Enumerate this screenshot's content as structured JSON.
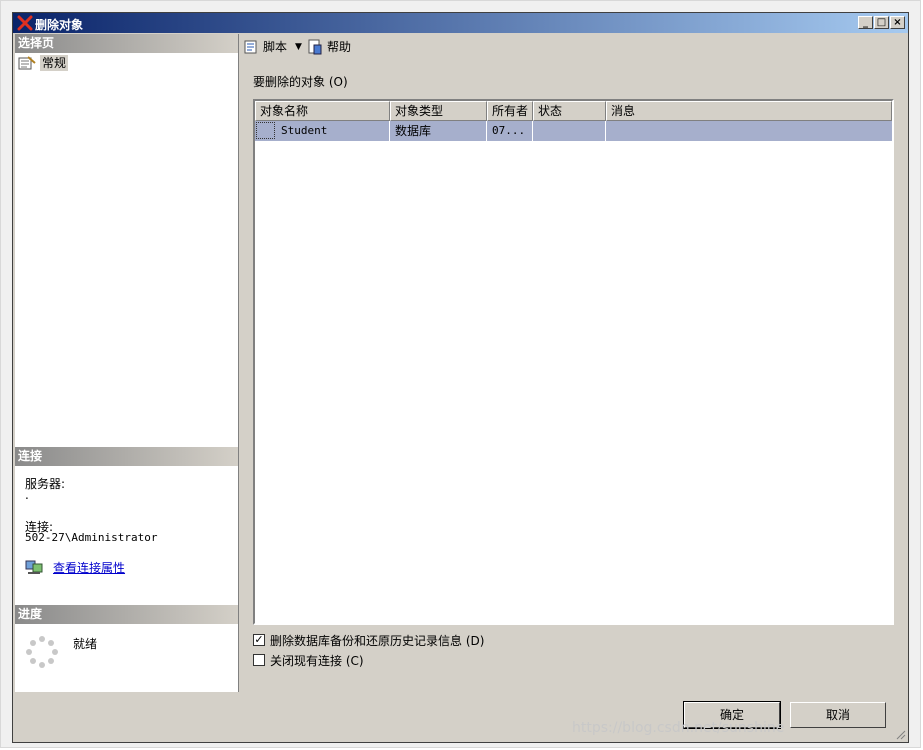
{
  "window": {
    "title": "删除对象"
  },
  "left_panel": {
    "select_page_header": "选择页",
    "nav_items": [
      {
        "label": "常规",
        "icon": "page-properties-icon"
      }
    ],
    "connection_header": "连接",
    "server_label": "服务器:",
    "server_value": ".",
    "connection_label": "连接:",
    "connection_value": "502-27\\Administrator",
    "view_connection_link": "查看连接属性",
    "progress_header": "进度",
    "progress_status": "就绪"
  },
  "toolbar": {
    "script_label": "脚本",
    "help_label": "帮助"
  },
  "main": {
    "objects_label": "要删除的对象 (O)",
    "table": {
      "columns": [
        "对象名称",
        "对象类型",
        "所有者",
        "状态",
        "消息"
      ],
      "rows": [
        {
          "name": "Student",
          "type": "数据库",
          "owner": "07...",
          "status": "",
          "message": ""
        }
      ]
    },
    "checkbox_delete_history": {
      "label": "删除数据库备份和还原历史记录信息 (D)",
      "checked": true
    },
    "checkbox_close_connections": {
      "label": "关闭现有连接 (C)",
      "checked": false
    }
  },
  "buttons": {
    "ok": "确定",
    "cancel": "取消"
  },
  "watermark": "https://blog.csdn.net/sunshine"
}
